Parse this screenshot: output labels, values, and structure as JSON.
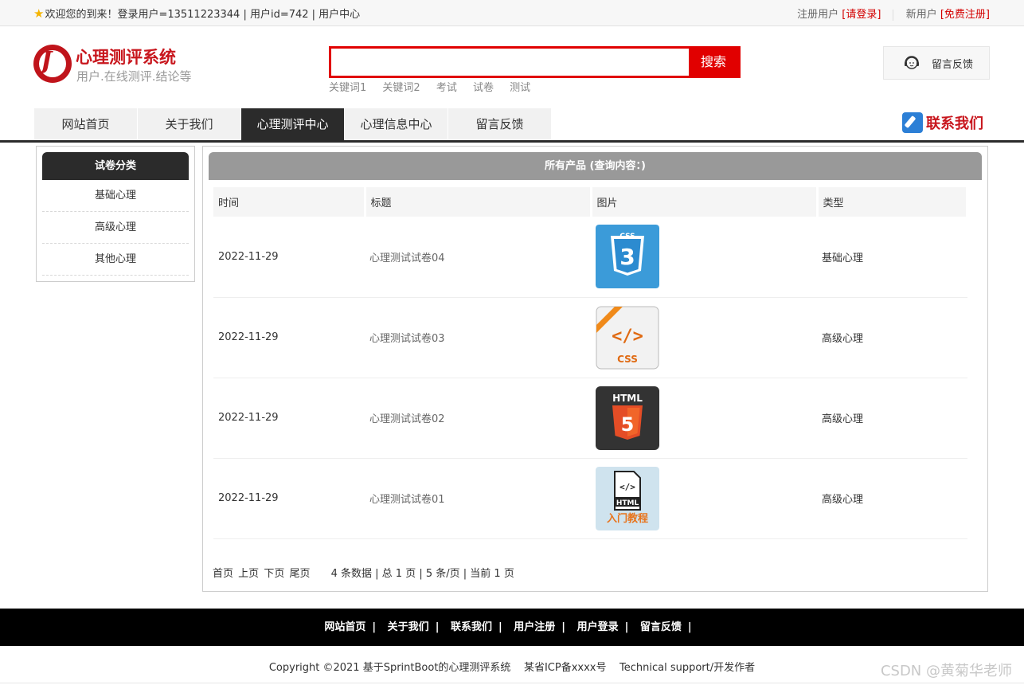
{
  "topbar": {
    "welcome": "欢迎您的到来！登录用户=13511223344 | 用户id=742 | 用户中心",
    "register_label": "注册用户",
    "login_link": "[请登录]",
    "new_user_label": "新用户",
    "signup_link": "[免费注册]"
  },
  "header": {
    "logo_title": "心理测评系统",
    "logo_subtitle": "用户.在线测评.结论等",
    "search_placeholder": "",
    "search_button": "搜索",
    "keywords": [
      "关键词1",
      "关键词2",
      "考试",
      "试卷",
      "测试"
    ],
    "feedback": "留言反馈"
  },
  "nav": {
    "items": [
      "网站首页",
      "关于我们",
      "心理测评中心",
      "心理信息中心",
      "留言反馈"
    ],
    "active_index": 2,
    "contact": "联系我们"
  },
  "sidebar": {
    "title": "试卷分类",
    "categories": [
      "基础心理",
      "高级心理",
      "其他心理"
    ]
  },
  "main": {
    "title": "所有产品 (查询内容：)",
    "columns": [
      "时间",
      "标题",
      "图片",
      "类型"
    ],
    "rows": [
      {
        "date": "2022-11-29",
        "title": "心理测试试卷04",
        "image": "css3-logo",
        "type": "基础心理"
      },
      {
        "date": "2022-11-29",
        "title": "心理测试试卷03",
        "image": "css-code-icon",
        "type": "高级心理"
      },
      {
        "date": "2022-11-29",
        "title": "心理测试试卷02",
        "image": "html5-logo",
        "type": "高级心理"
      },
      {
        "date": "2022-11-29",
        "title": "心理测试试卷01",
        "image": "html-tutorial-icon",
        "type": "高级心理"
      }
    ],
    "pager": {
      "links": [
        "首页",
        "上页",
        "下页",
        "尾页"
      ],
      "info": "4 条数据 | 总 1 页 | 5 条/页 | 当前 1 页"
    }
  },
  "footer": {
    "links": [
      "网站首页",
      "关于我们",
      "联系我们",
      "用户注册",
      "用户登录",
      "留言反馈"
    ],
    "copyright": "Copyright ©2021 基于SprintBoot的心理测评系统    某省ICP备xxxx号    Technical support/开发作者",
    "watermark": "CSDN @黄菊华老师"
  },
  "colors": {
    "brand_red": "#c8161d",
    "search_red": "#e10000",
    "nav_dark": "#2b2b2b",
    "panel_gray": "#999999"
  }
}
